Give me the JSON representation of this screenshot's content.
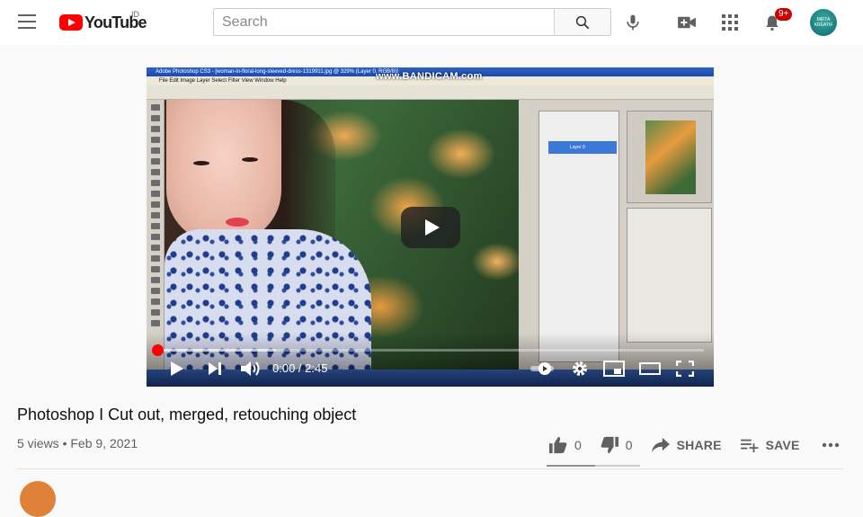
{
  "header": {
    "logo_text": "YouTube",
    "country_code": "ID",
    "search_placeholder": "Search",
    "notification_count": "9+",
    "avatar_text": "MIFTA KREATIF"
  },
  "player": {
    "current_time": "0:00",
    "duration": "2:45",
    "time_separator": " / ",
    "progress_fraction": 0.0,
    "watermark": "www.BANDICAM.com",
    "ps_title": "Adobe Photoshop CS3 - [woman-in-floral-long-sleeved-dress-1319911.jpg @ 329% (Layer 0, RGB/8)]",
    "ps_menu": "File  Edit  Image  Layer  Select  Filter  View  Window  Help",
    "ps_layer_name": "Layer 0"
  },
  "video": {
    "title": "Photoshop I Cut out, merged, retouching object",
    "views": "5 views",
    "date": "Feb 9, 2021",
    "separator": " • "
  },
  "actions": {
    "likes": "0",
    "dislikes": "0",
    "share_label": "SHARE",
    "save_label": "SAVE"
  },
  "colors": {
    "brand_red": "#ff0000",
    "badge_red": "#cc0000",
    "text_secondary": "#606060"
  },
  "icons": [
    "menu-icon",
    "youtube-logo-icon",
    "search-icon",
    "mic-icon",
    "create-video-icon",
    "apps-icon",
    "bell-icon",
    "play-icon",
    "next-icon",
    "volume-icon",
    "autoplay-toggle",
    "settings-gear-icon",
    "miniplayer-icon",
    "theater-icon",
    "fullscreen-icon",
    "thumbs-up-icon",
    "thumbs-down-icon",
    "share-icon",
    "playlist-add-icon",
    "more-icon"
  ]
}
